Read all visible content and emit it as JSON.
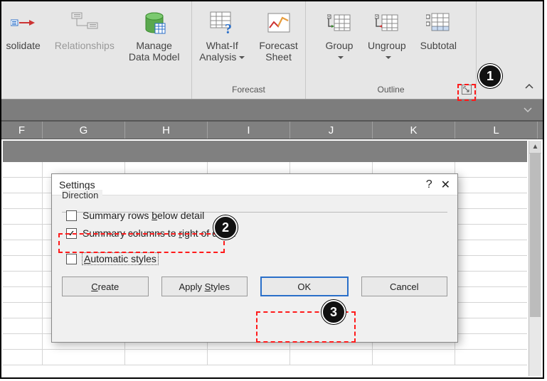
{
  "ribbon": {
    "buttons": {
      "consolidate": {
        "label": "solidate"
      },
      "relationships": {
        "label": "Relationships"
      },
      "dataModel": {
        "line1": "Manage",
        "line2": "Data Model"
      },
      "whatIf": {
        "line1": "What-If",
        "line2": "Analysis"
      },
      "forecastSheet": {
        "line1": "Forecast",
        "line2": "Sheet"
      },
      "group": {
        "label": "Group"
      },
      "ungroup": {
        "label": "Ungroup"
      },
      "subtotal": {
        "label": "Subtotal"
      }
    },
    "groups": {
      "forecast": "Forecast",
      "outline": "Outline"
    }
  },
  "columns": [
    "F",
    "G",
    "H",
    "I",
    "J",
    "K",
    "L"
  ],
  "dialog": {
    "title": "Settings",
    "help": "?",
    "close": "✕",
    "groupLabel": "Direction",
    "chk_below_pre": "Summary rows ",
    "chk_below_u": "b",
    "chk_below_post": "elow detail",
    "chk_right_pre": "Summary columns to ",
    "chk_right_u": "r",
    "chk_right_post": "ight of detail",
    "chk_auto_u": "A",
    "chk_auto_post": "utomatic styles",
    "btn_create_u": "C",
    "btn_create_post": "reate",
    "btn_apply_pre": "Apply ",
    "btn_apply_u": "S",
    "btn_apply_post": "tyles",
    "btn_ok": "OK",
    "btn_cancel": "Cancel"
  },
  "callouts": {
    "n1": "1",
    "n2": "2",
    "n3": "3"
  }
}
